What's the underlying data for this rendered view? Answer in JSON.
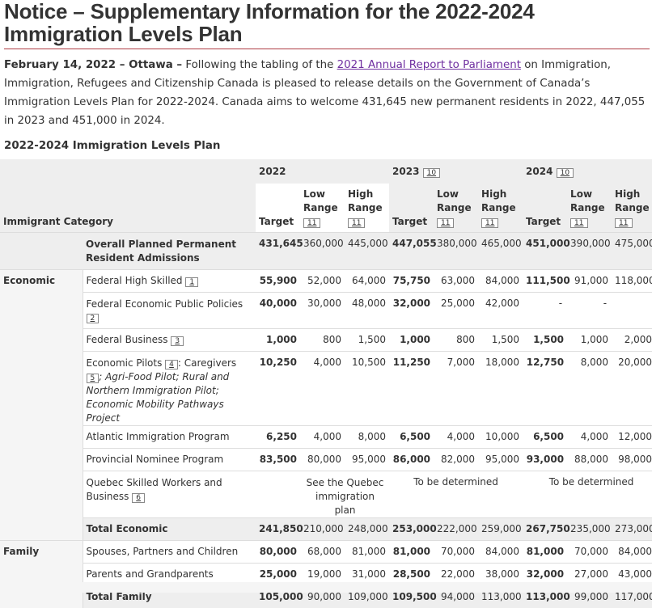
{
  "title_line1": "Notice – Supplementary Information for the 2022-2024",
  "title_line2": "Immigration Levels Plan",
  "intro": {
    "dateline": "February 14, 2022 – Ottawa –",
    "text_before_link": " Following the tabling of the ",
    "link": "2021 Annual Report to Parliament",
    "text_after_link": " on Immigration, Immigration, Refugees and Citizenship Canada is pleased to release details on the Government of Canada’s Immigration Levels Plan for 2022-2024. Canada aims to welcome 431,645 new permanent residents in 2022, 447,055 in 2023 and 451,000 in 2024."
  },
  "table_caption": "2022-2024 Immigration Levels Plan",
  "header": {
    "category": "Immigrant Category",
    "years": [
      "2022",
      "2023",
      "2024"
    ],
    "year_fn": [
      "",
      "10",
      "10"
    ],
    "target": "Target",
    "low": "Low Range",
    "high": "High Range",
    "range_fn": "11"
  },
  "rows": {
    "overall": {
      "label": "Overall Planned Permanent Resident Admissions",
      "v": [
        "431,645",
        "360,000",
        "445,000",
        "447,055",
        "380,000",
        "465,000",
        "451,000",
        "390,000",
        "475,000"
      ]
    },
    "economic_cat": "Economic",
    "fhs": {
      "label": "Federal High Skilled",
      "fn": "1",
      "v": [
        "55,900",
        "52,000",
        "64,000",
        "75,750",
        "63,000",
        "84,000",
        "111,500",
        "91,000",
        "118,000"
      ]
    },
    "fepp": {
      "label": "Federal Economic Public Policies",
      "fn": "2",
      "v": [
        "40,000",
        "30,000",
        "48,000",
        "32,000",
        "25,000",
        "42,000",
        "-",
        "-",
        ""
      ]
    },
    "fb": {
      "label": "Federal Business",
      "fn": "3",
      "v": [
        "1,000",
        "800",
        "1,500",
        "1,000",
        "800",
        "1,500",
        "1,500",
        "1,000",
        "2,000"
      ]
    },
    "ep": {
      "label": "Economic Pilots",
      "fn": "4",
      "label2": ": Caregivers",
      "fn2": "5",
      "label3": "; Agri-Food Pilot; Rural and Northern Immigration Pilot; Economic Mobility Pathways Project",
      "v": [
        "10,250",
        "4,000",
        "10,500",
        "11,250",
        "7,000",
        "18,000",
        "12,750",
        "8,000",
        "20,000"
      ]
    },
    "aip": {
      "label": "Atlantic Immigration Program",
      "v": [
        "6,250",
        "4,000",
        "8,000",
        "6,500",
        "4,000",
        "10,000",
        "6,500",
        "4,000",
        "12,000"
      ]
    },
    "pnp": {
      "label": "Provincial Nominee Program",
      "v": [
        "83,500",
        "80,000",
        "95,000",
        "86,000",
        "82,000",
        "95,000",
        "93,000",
        "88,000",
        "98,000"
      ]
    },
    "qsw": {
      "label": "Quebec Skilled Workers and Business",
      "fn": "6",
      "v2022": "See the Quebec immigration plan",
      "v2023": "To be determined",
      "v2024": "To be determined"
    },
    "tot_econ": {
      "label": "Total Economic",
      "v": [
        "241,850",
        "210,000",
        "248,000",
        "253,000",
        "222,000",
        "259,000",
        "267,750",
        "235,000",
        "273,000"
      ]
    },
    "family_cat": "Family",
    "spc": {
      "label": "Spouses, Partners and Children",
      "v": [
        "80,000",
        "68,000",
        "81,000",
        "81,000",
        "70,000",
        "84,000",
        "81,000",
        "70,000",
        "84,000"
      ]
    },
    "pg": {
      "label": "Parents and Grandparents",
      "v": [
        "25,000",
        "19,000",
        "31,000",
        "28,500",
        "22,000",
        "38,000",
        "32,000",
        "27,000",
        "43,000"
      ]
    },
    "tot_fam": {
      "label": "Total Family",
      "v": [
        "105,000",
        "90,000",
        "109,000",
        "109,500",
        "94,000",
        "113,000",
        "113,000",
        "99,000",
        "117,000"
      ]
    }
  }
}
